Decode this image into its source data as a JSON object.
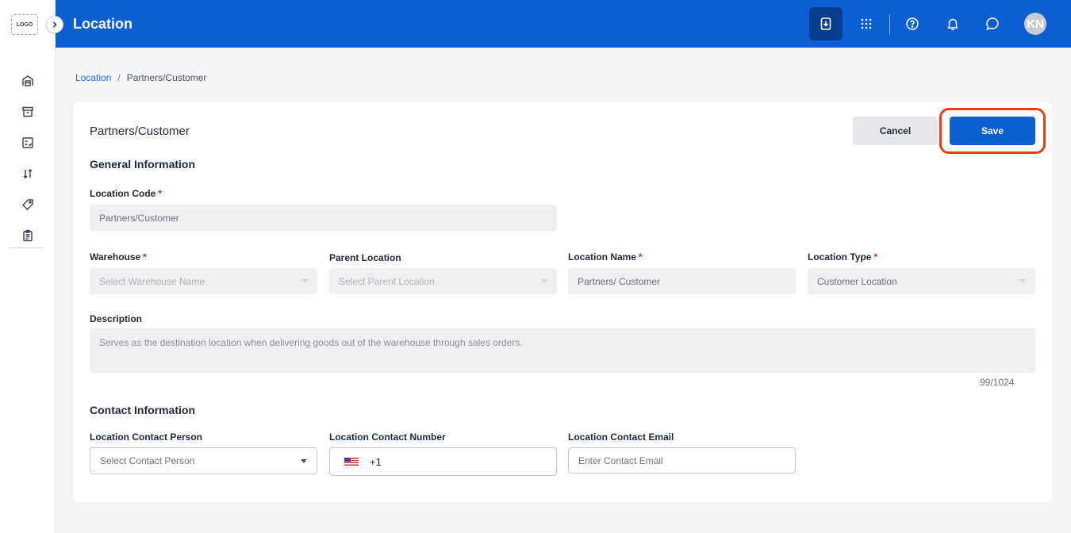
{
  "sidebar": {
    "logo_text": "LOGO",
    "items": [
      {
        "icon": "warehouse-icon"
      },
      {
        "icon": "archive-box-icon"
      },
      {
        "icon": "checklist-icon"
      },
      {
        "icon": "sort-arrows-icon"
      },
      {
        "icon": "tag-icon"
      },
      {
        "icon": "clipboard-icon"
      }
    ]
  },
  "header": {
    "title": "Location",
    "avatar_initials": "KN",
    "actions": [
      "download-icon",
      "apps-grid-icon",
      "help-icon",
      "bell-icon",
      "chat-icon"
    ]
  },
  "breadcrumb": {
    "root": "Location",
    "separator": "/",
    "current": "Partners/Customer"
  },
  "card": {
    "title": "Partners/Customer",
    "cancel_label": "Cancel",
    "save_label": "Save"
  },
  "general": {
    "section_title": "General Information",
    "location_code": {
      "label": "Location Code",
      "required": "*",
      "value": "Partners/Customer"
    },
    "warehouse": {
      "label": "Warehouse",
      "required": "*",
      "placeholder": "Select Warehouse Name"
    },
    "parent_location": {
      "label": "Parent Location",
      "placeholder": "Select Parent Location"
    },
    "location_name": {
      "label": "Location Name",
      "required": "*",
      "value": "Partners/ Customer"
    },
    "location_type": {
      "label": "Location Type",
      "required": "*",
      "value": "Customer Location"
    },
    "description": {
      "label": "Description",
      "value": "Serves as the destination location when delivering goods out of the warehouse through sales orders.",
      "counter": "99/1024"
    }
  },
  "contact": {
    "section_title": "Contact Information",
    "person": {
      "label": "Location Contact Person",
      "placeholder": "Select Contact Person"
    },
    "number": {
      "label": "Location Contact Number",
      "value": "+1"
    },
    "email": {
      "label": "Location Contact Email",
      "placeholder": "Enter Contact Email"
    }
  },
  "colors": {
    "primary": "#0b5fd0",
    "highlight": "#f03a17",
    "required": "#e11d48"
  }
}
